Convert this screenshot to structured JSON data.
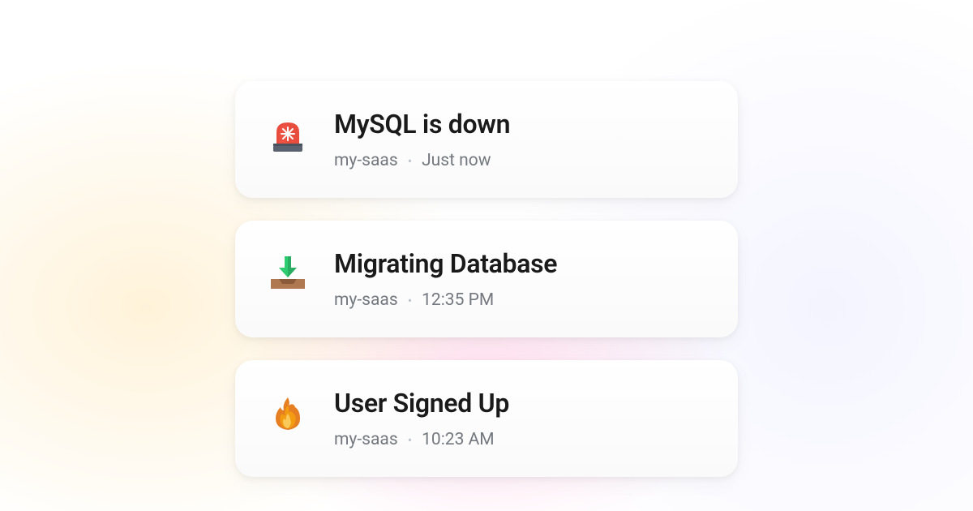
{
  "notifications": [
    {
      "icon": "siren-icon",
      "title": "MySQL is down",
      "source": "my-saas",
      "time": "Just now"
    },
    {
      "icon": "inbox-download-icon",
      "title": "Migrating Database",
      "source": "my-saas",
      "time": "12:35 PM"
    },
    {
      "icon": "fire-icon",
      "title": "User Signed Up",
      "source": "my-saas",
      "time": "10:23 AM"
    }
  ]
}
